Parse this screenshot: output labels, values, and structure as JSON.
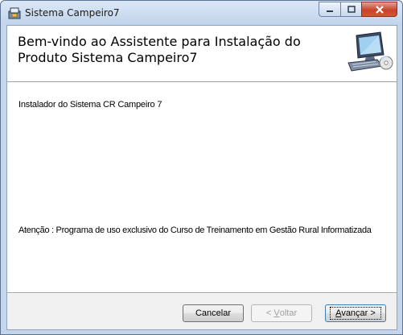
{
  "window": {
    "title": "Sistema  Campeiro7",
    "icon": "installer-icon"
  },
  "banner": {
    "title": "Bem-vindo ao Assistente para Instalação do Produto Sistema  Campeiro7",
    "graphic": "computer-cd-icon"
  },
  "content": {
    "intro": "Instalador do Sistema CR Campeiro 7",
    "notice": "Atenção : Programa de uso exclusivo do Curso de Treinamento em Gestão Rural Informatizada"
  },
  "buttons": {
    "cancel": "Cancelar",
    "back_prefix": "< ",
    "back_mnemonic": "V",
    "back_rest": "oltar",
    "next_mnemonic": "A",
    "next_rest": "vançar >"
  },
  "colors": {
    "title_bar": "#c1d4ec",
    "close_button": "#c9432b",
    "default_button_border": "#3c7fb1"
  }
}
